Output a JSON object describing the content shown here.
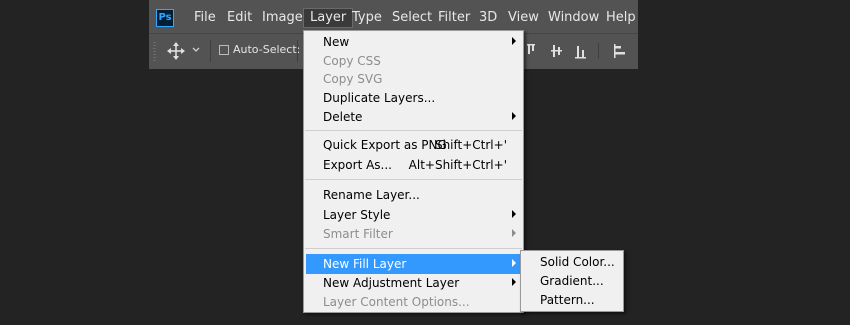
{
  "app": {
    "logo_text": "Ps",
    "brand_color": "#31a8ff"
  },
  "menubar": {
    "items": [
      "File",
      "Edit",
      "Image",
      "Layer",
      "Type",
      "Select",
      "Filter",
      "3D",
      "View",
      "Window",
      "Help"
    ],
    "active": "Layer"
  },
  "options_bar": {
    "auto_select_label": "Auto-Select:",
    "auto_select_checked": false
  },
  "layer_menu": {
    "items": [
      {
        "label": "New",
        "disabled": false,
        "submenu": true
      },
      {
        "label": "Copy CSS",
        "disabled": true
      },
      {
        "label": "Copy SVG",
        "disabled": true
      },
      {
        "label": "Duplicate Layers...",
        "disabled": false
      },
      {
        "label": "Delete",
        "disabled": false,
        "submenu": true
      },
      {
        "label": "Quick Export as PNG",
        "shortcut": "Shift+Ctrl+'",
        "disabled": false
      },
      {
        "label": "Export As...",
        "shortcut": "Alt+Shift+Ctrl+'",
        "disabled": false
      },
      {
        "label": "Rename Layer...",
        "disabled": false
      },
      {
        "label": "Layer Style",
        "disabled": false,
        "submenu": true
      },
      {
        "label": "Smart Filter",
        "disabled": true,
        "submenu": true
      },
      {
        "label": "New Fill Layer",
        "disabled": false,
        "submenu": true,
        "highlighted": true
      },
      {
        "label": "New Adjustment Layer",
        "disabled": false,
        "submenu": true
      },
      {
        "label": "Layer Content Options...",
        "disabled": true
      }
    ]
  },
  "fill_layer_submenu": {
    "items": [
      "Solid Color...",
      "Gradient...",
      "Pattern..."
    ]
  },
  "colors": {
    "highlight": "#3399ff",
    "menu_bg": "#f0f0f0",
    "chrome": "#535353",
    "canvas": "#232323"
  }
}
